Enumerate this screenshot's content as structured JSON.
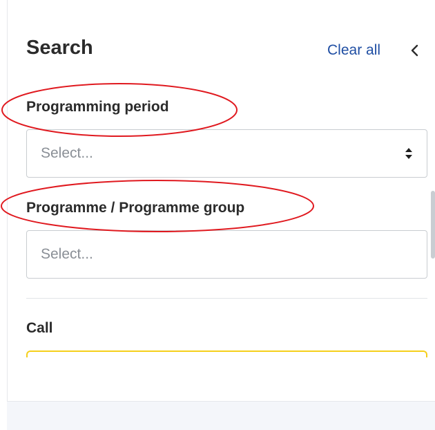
{
  "panel": {
    "title": "Search",
    "clear_all_label": "Clear all"
  },
  "filters": {
    "programming_period": {
      "label": "Programming period",
      "placeholder": "Select..."
    },
    "programme": {
      "label": "Programme / Programme group",
      "placeholder": "Select..."
    },
    "call": {
      "label": "Call"
    }
  },
  "icons": {
    "collapse": "chevron-left-icon",
    "select_toggle": "sort-arrows-icon"
  },
  "colors": {
    "link": "#1f4ea3",
    "focus_border": "#f5cf1b",
    "annotation": "#e0191f",
    "label_text": "#2b2b2b",
    "placeholder_text": "#8a8f96"
  }
}
